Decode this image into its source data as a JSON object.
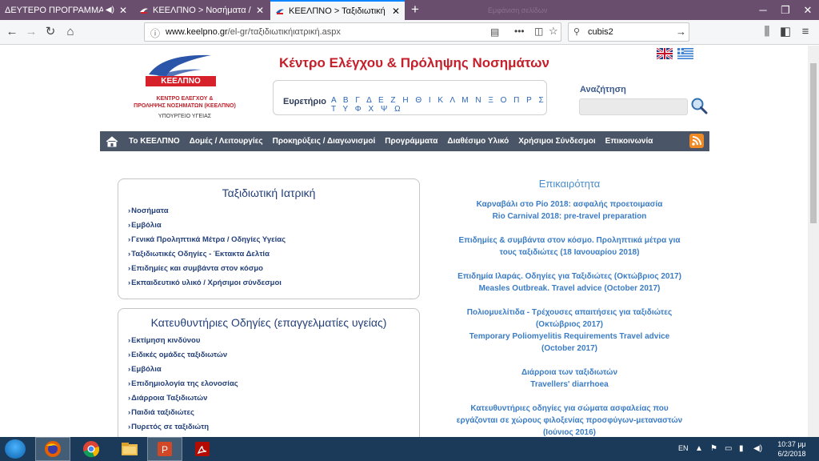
{
  "browser": {
    "tabs": [
      {
        "title": "ΔΕΥΤΕΡΟ ΠΡΟΓΡΑΜΜΑ | ΕΡΤ W"
      },
      {
        "title": "ΚΕΕΛΠΝΟ > Νοσήματα / Θέμα"
      },
      {
        "title": "ΚΕΕΛΠΝΟ > Ταξιδιωτική ιατρική"
      }
    ],
    "url_host": "www.keelpno.gr",
    "url_path": "/el-gr/ταξιδιωτικήιατρική.aspx",
    "search_value": "cubis2",
    "faint_text": "Εμφάνιση σελίδων"
  },
  "site": {
    "logo_name": "ΚΕΕΛΠΝΟ",
    "logo_sub_line1": "ΚΕΝΤΡΟ ΕΛΕΓΧΟΥ &",
    "logo_sub_line2": "ΠΡΟΛΗΨΗΣ ΝΟΣΗΜΑΤΩΝ (ΚΕΕΛΠΝΟ)",
    "logo_ministry": "ΥΠΟΥΡΓΕΙΟ ΥΓΕΙΑΣ",
    "title": "Κέντρο Ελέγχου & Πρόληψης Νοσημάτων",
    "index_label": "Ευρετήριο",
    "index_letters": "Α Β Γ Δ Ε Ζ Η Θ Ι Κ Λ Μ Ν Ξ Ο Π Ρ Σ Τ Υ Φ Χ Ψ Ω",
    "search_label": "Αναζήτηση"
  },
  "menu": [
    "Το ΚΕΕΛΠΝΟ",
    "Δομές / Λειτουργίες",
    "Προκηρύξεις / Διαγωνισμοί",
    "Προγράμματα",
    "Διαθέσιμο Υλικό",
    "Χρήσιμοι Σύνδεσμοι",
    "Επικοινωνία"
  ],
  "travel_box": {
    "title": "Ταξιδιωτική Ιατρική",
    "links": [
      "Νοσήματα",
      "Εμβόλια",
      "Γενικά Προληπτικά Μέτρα / Οδηγίες Υγείας",
      "Ταξιδιωτικές Οδηγίες - Έκτακτα Δελτία",
      "Επιδημίες και συμβάντα στον κόσμο",
      "Εκπαιδευτικό υλικό / Χρήσιμοι σύνδεσμοι"
    ]
  },
  "guidelines_box": {
    "title": "Κατευθυντήριες Οδηγίες (επαγγελματίες υγείας)",
    "links": [
      "Εκτίμηση κινδύνου",
      "Ειδικές ομάδες ταξιδιωτών",
      "Εμβόλια",
      "Επιδημιολογία της ελονοσίας",
      "Διάρροια Ταξιδιωτών",
      "Παιδιά ταξιδιώτες",
      "Πυρετός σε ταξιδιώτη"
    ]
  },
  "news": {
    "title": "Επικαιρότητα",
    "items": [
      "Καρναβάλι στο Ρίο 2018: ασφαλής προετοιμασία\nRio Carnival 2018: pre-travel preparation",
      "Επιδημίες & συμβάντα στον κόσμο. Προληπτικά μέτρα για τους ταξιδιώτες (18 Ιανουαρίου 2018)",
      "Επιδημία Ιλαράς. Οδηγίες για Ταξιδιώτες (Οκτώβριος 2017)\nMeasles Outbreak. Travel advice (October 2017)",
      "Πολιομυελίτιδα - Τρέχουσες απαιτήσεις για ταξιδιώτες (Οκτώβριος 2017)\nTemporary Poliomyelitis Requirements Travel advice (October 2017)",
      "Διάρροια των ταξιδιωτών\nTravellers' diarrhoea",
      "Κατευθυντήριες οδηγίες για σώματα ασφαλείας που εργάζονται σε χώρους φιλοξενίας προσφύγων-μεταναστών (Ιούνιος 2016)"
    ]
  },
  "taskbar": {
    "lang": "EN",
    "time": "10:37 μμ",
    "date": "6/2/2018"
  },
  "colors": {
    "tabstrip": "#6a4e6e",
    "brand_red": "#c41f2b",
    "menu_bg": "#4a5568",
    "link_blue": "#24407a",
    "news_blue": "#3b7cc4",
    "taskbar": "#1b3a5a"
  }
}
